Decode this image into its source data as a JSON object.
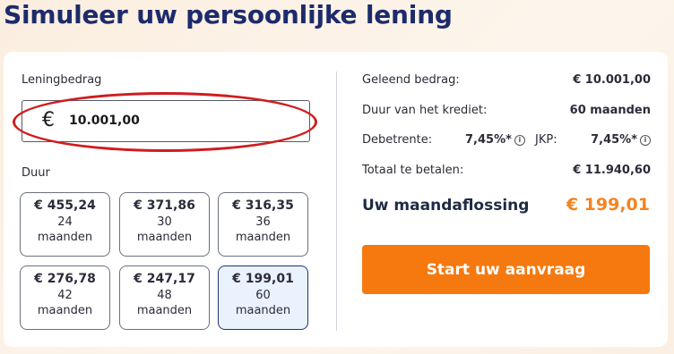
{
  "title": "Simuleer uw persoonlijke lening",
  "loan": {
    "amount_label": "Leningbedrag",
    "currency_symbol": "€",
    "amount_value": "10.001,00"
  },
  "duration": {
    "label": "Duur",
    "options": [
      {
        "amount": "€ 455,24",
        "months": "24",
        "unit": "maanden",
        "selected": false
      },
      {
        "amount": "€ 371,86",
        "months": "30",
        "unit": "maanden",
        "selected": false
      },
      {
        "amount": "€ 316,35",
        "months": "36",
        "unit": "maanden",
        "selected": false
      },
      {
        "amount": "€ 276,78",
        "months": "42",
        "unit": "maanden",
        "selected": false
      },
      {
        "amount": "€ 247,17",
        "months": "48",
        "unit": "maanden",
        "selected": false
      },
      {
        "amount": "€ 199,01",
        "months": "60",
        "unit": "maanden",
        "selected": true
      }
    ]
  },
  "summary": {
    "borrowed_label": "Geleend bedrag:",
    "borrowed_value": "€ 10.001,00",
    "term_label": "Duur van het krediet:",
    "term_value": "60 maanden",
    "debit_rate_label": "Debetrente:",
    "debit_rate_value": "7,45%*",
    "apr_label": "JKP:",
    "apr_value": "7,45%*",
    "total_label": "Totaal te betalen:",
    "total_value": "€ 11.940,60",
    "monthly_label": "Uw maandaflossing",
    "monthly_value": "€ 199,01",
    "cta_label": "Start uw aanvraag"
  },
  "colors": {
    "accent": "#f5790f",
    "title": "#1d2b6b",
    "selected_bg": "#eaf2fd",
    "highlight_ring": "#d01c1f"
  }
}
